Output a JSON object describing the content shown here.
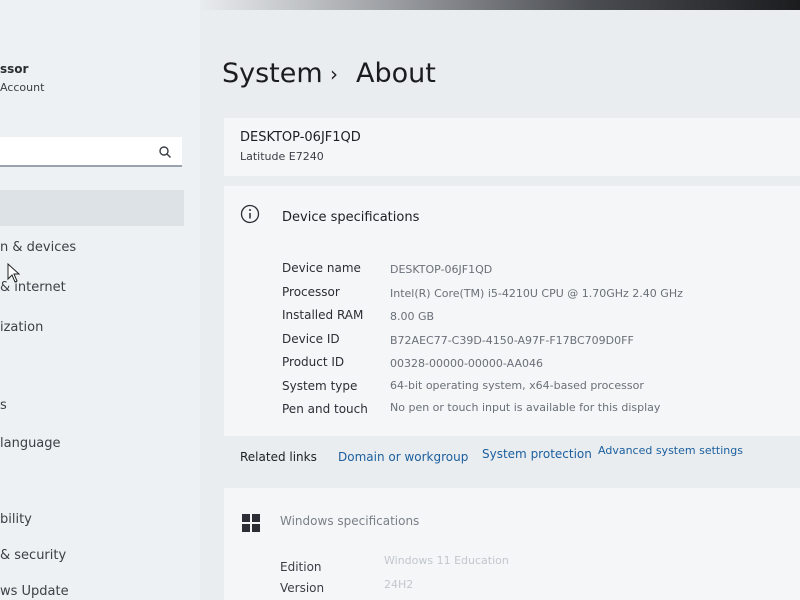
{
  "sidebar": {
    "account_name": "ssor",
    "account_sub": "Account",
    "search_placeholder": "",
    "items": [
      {
        "label": "n & devices"
      },
      {
        "label": "& internet"
      },
      {
        "label": "ization"
      },
      {
        "label": "s"
      },
      {
        "label": "language"
      },
      {
        "label": "bility"
      },
      {
        "label": "& security"
      },
      {
        "label": "ws Update"
      }
    ]
  },
  "breadcrumb": {
    "parent": "System",
    "separator": "›",
    "current": "About"
  },
  "device": {
    "name": "DESKTOP-06JF1QD",
    "model": "Latitude E7240"
  },
  "device_specs": {
    "title": "Device specifications",
    "rows": [
      {
        "label": "Device name",
        "value": "DESKTOP-06JF1QD"
      },
      {
        "label": "Processor",
        "value": "Intel(R) Core(TM) i5-4210U CPU @ 1.70GHz   2.40 GHz"
      },
      {
        "label": "Installed RAM",
        "value": "8.00 GB"
      },
      {
        "label": "Device ID",
        "value": "B72AEC77-C39D-4150-A97F-F17BC709D0FF"
      },
      {
        "label": "Product ID",
        "value": "00328-00000-00000-AA046"
      },
      {
        "label": "System type",
        "value": "64-bit operating system, x64-based processor"
      },
      {
        "label": "Pen and touch",
        "value": "No pen or touch input is available for this display"
      }
    ]
  },
  "related": {
    "label": "Related links",
    "links": [
      "Domain or workgroup",
      "System protection",
      "Advanced system settings"
    ]
  },
  "windows_specs": {
    "title": "Windows specifications",
    "rows": [
      {
        "label": "Edition",
        "value": "Windows 11 Education"
      },
      {
        "label": "Version",
        "value": "24H2"
      }
    ]
  },
  "icons": {
    "search": "search-icon",
    "info": "info-icon",
    "windows": "windows-logo-icon",
    "cursor": "mouse-cursor-icon"
  },
  "colors": {
    "link": "#1b5f9e",
    "background": "#eaedf0",
    "card": "#f4f6f8"
  }
}
